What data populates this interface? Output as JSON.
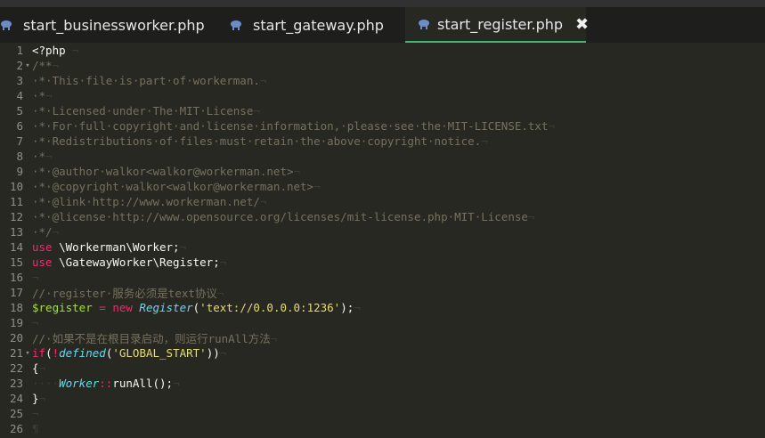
{
  "tabs": [
    {
      "label": "start_businessworker.php",
      "active": false
    },
    {
      "label": "start_gateway.php",
      "active": false
    },
    {
      "label": "start_register.php",
      "active": true
    }
  ],
  "tab_close_glyph": "✖",
  "colors": {
    "background": "#272822",
    "tabbar": "#1e1f1c",
    "active_tab_underline": "#4caf6a",
    "comment": "#75715e",
    "keyword": "#f92672",
    "string": "#e6db74",
    "class": "#66d9ef",
    "variable": "#a6e22e",
    "text": "#f8f8f2"
  },
  "code_lines": [
    {
      "number": "1",
      "fold": "",
      "tokens": [
        {
          "t": "<?php",
          "c": "text"
        },
        {
          "t": " ¬",
          "c": "ws"
        }
      ]
    },
    {
      "number": "2",
      "fold": "▾",
      "tokens": [
        {
          "t": "/**",
          "c": "comment"
        },
        {
          "t": "¬",
          "c": "ws"
        }
      ]
    },
    {
      "number": "3",
      "fold": "",
      "tokens": [
        {
          "t": "·*·This·file·is·part·of·workerman.",
          "c": "comment"
        },
        {
          "t": "¬",
          "c": "ws"
        }
      ]
    },
    {
      "number": "4",
      "fold": "",
      "tokens": [
        {
          "t": "·*",
          "c": "comment"
        },
        {
          "t": "¬",
          "c": "ws"
        }
      ]
    },
    {
      "number": "5",
      "fold": "",
      "tokens": [
        {
          "t": "·*·Licensed·under·The·MIT·License",
          "c": "comment"
        },
        {
          "t": "¬",
          "c": "ws"
        }
      ]
    },
    {
      "number": "6",
      "fold": "",
      "tokens": [
        {
          "t": "·*·For·full·copyright·and·license·information,·please·see·the·MIT-LICENSE.txt",
          "c": "comment"
        },
        {
          "t": "¬",
          "c": "ws"
        }
      ]
    },
    {
      "number": "7",
      "fold": "",
      "tokens": [
        {
          "t": "·*·Redistributions·of·files·must·retain·the·above·copyright·notice.",
          "c": "comment"
        },
        {
          "t": "¬",
          "c": "ws"
        }
      ]
    },
    {
      "number": "8",
      "fold": "",
      "tokens": [
        {
          "t": "·*",
          "c": "comment"
        },
        {
          "t": "¬",
          "c": "ws"
        }
      ]
    },
    {
      "number": "9",
      "fold": "",
      "tokens": [
        {
          "t": "·*·@author·walkor<walkor@workerman.net>",
          "c": "comment"
        },
        {
          "t": "¬",
          "c": "ws"
        }
      ]
    },
    {
      "number": "10",
      "fold": "",
      "tokens": [
        {
          "t": "·*·@copyright·walkor<walkor@workerman.net>",
          "c": "comment"
        },
        {
          "t": "¬",
          "c": "ws"
        }
      ]
    },
    {
      "number": "11",
      "fold": "",
      "tokens": [
        {
          "t": "·*·@link·http://www.workerman.net/",
          "c": "comment"
        },
        {
          "t": "¬",
          "c": "ws"
        }
      ]
    },
    {
      "number": "12",
      "fold": "",
      "tokens": [
        {
          "t": "·*·@license·http://www.opensource.org/licenses/mit-license.php·MIT·License",
          "c": "comment"
        },
        {
          "t": "¬",
          "c": "ws"
        }
      ]
    },
    {
      "number": "13",
      "fold": "",
      "tokens": [
        {
          "t": "·*/",
          "c": "comment"
        },
        {
          "t": "¬",
          "c": "ws"
        }
      ]
    },
    {
      "number": "14",
      "fold": "",
      "tokens": [
        {
          "t": "use",
          "c": "keyword"
        },
        {
          "t": " \\Workerman\\Worker;",
          "c": "text"
        },
        {
          "t": "¬",
          "c": "ws"
        }
      ]
    },
    {
      "number": "15",
      "fold": "",
      "tokens": [
        {
          "t": "use",
          "c": "keyword"
        },
        {
          "t": " \\GatewayWorker\\Register;",
          "c": "text"
        },
        {
          "t": "¬",
          "c": "ws"
        }
      ]
    },
    {
      "number": "16",
      "fold": "",
      "tokens": [
        {
          "t": "¬",
          "c": "ws"
        }
      ]
    },
    {
      "number": "17",
      "fold": "",
      "tokens": [
        {
          "t": "//·register·服务必须是text协议",
          "c": "comment"
        },
        {
          "t": "¬",
          "c": "ws"
        }
      ]
    },
    {
      "number": "18",
      "fold": "",
      "tokens": [
        {
          "t": "$register",
          "c": "variable"
        },
        {
          "t": " = ",
          "c": "operator"
        },
        {
          "t": "new",
          "c": "keyword"
        },
        {
          "t": " ",
          "c": "text"
        },
        {
          "t": "Register",
          "c": "class"
        },
        {
          "t": "(",
          "c": "text"
        },
        {
          "t": "'text://0.0.0.0:1236'",
          "c": "string"
        },
        {
          "t": ");",
          "c": "text"
        },
        {
          "t": "¬",
          "c": "ws"
        }
      ]
    },
    {
      "number": "19",
      "fold": "",
      "tokens": [
        {
          "t": "¬",
          "c": "ws"
        }
      ]
    },
    {
      "number": "20",
      "fold": "",
      "tokens": [
        {
          "t": "//·如果不是在根目录启动，则运行runAll方法",
          "c": "comment"
        },
        {
          "t": "¬",
          "c": "ws"
        }
      ]
    },
    {
      "number": "21",
      "fold": "▾",
      "tokens": [
        {
          "t": "if",
          "c": "keyword"
        },
        {
          "t": "(",
          "c": "text"
        },
        {
          "t": "!",
          "c": "operator"
        },
        {
          "t": "defined",
          "c": "class"
        },
        {
          "t": "(",
          "c": "text"
        },
        {
          "t": "'GLOBAL_START'",
          "c": "string"
        },
        {
          "t": "))",
          "c": "text"
        },
        {
          "t": "¬",
          "c": "ws"
        }
      ]
    },
    {
      "number": "22",
      "fold": "",
      "tokens": [
        {
          "t": "{",
          "c": "text"
        },
        {
          "t": "¬",
          "c": "ws"
        }
      ]
    },
    {
      "number": "23",
      "fold": "",
      "tokens": [
        {
          "t": "····",
          "c": "ws"
        },
        {
          "t": "Worker",
          "c": "class"
        },
        {
          "t": "::",
          "c": "operator"
        },
        {
          "t": "runAll();",
          "c": "text"
        },
        {
          "t": "¬",
          "c": "ws"
        }
      ]
    },
    {
      "number": "24",
      "fold": "",
      "tokens": [
        {
          "t": "}",
          "c": "text"
        },
        {
          "t": "¬",
          "c": "ws"
        }
      ]
    },
    {
      "number": "25",
      "fold": "",
      "tokens": [
        {
          "t": "¬",
          "c": "ws"
        }
      ]
    },
    {
      "number": "26",
      "fold": "",
      "tokens": [
        {
          "t": "¶",
          "c": "ws"
        }
      ]
    }
  ]
}
